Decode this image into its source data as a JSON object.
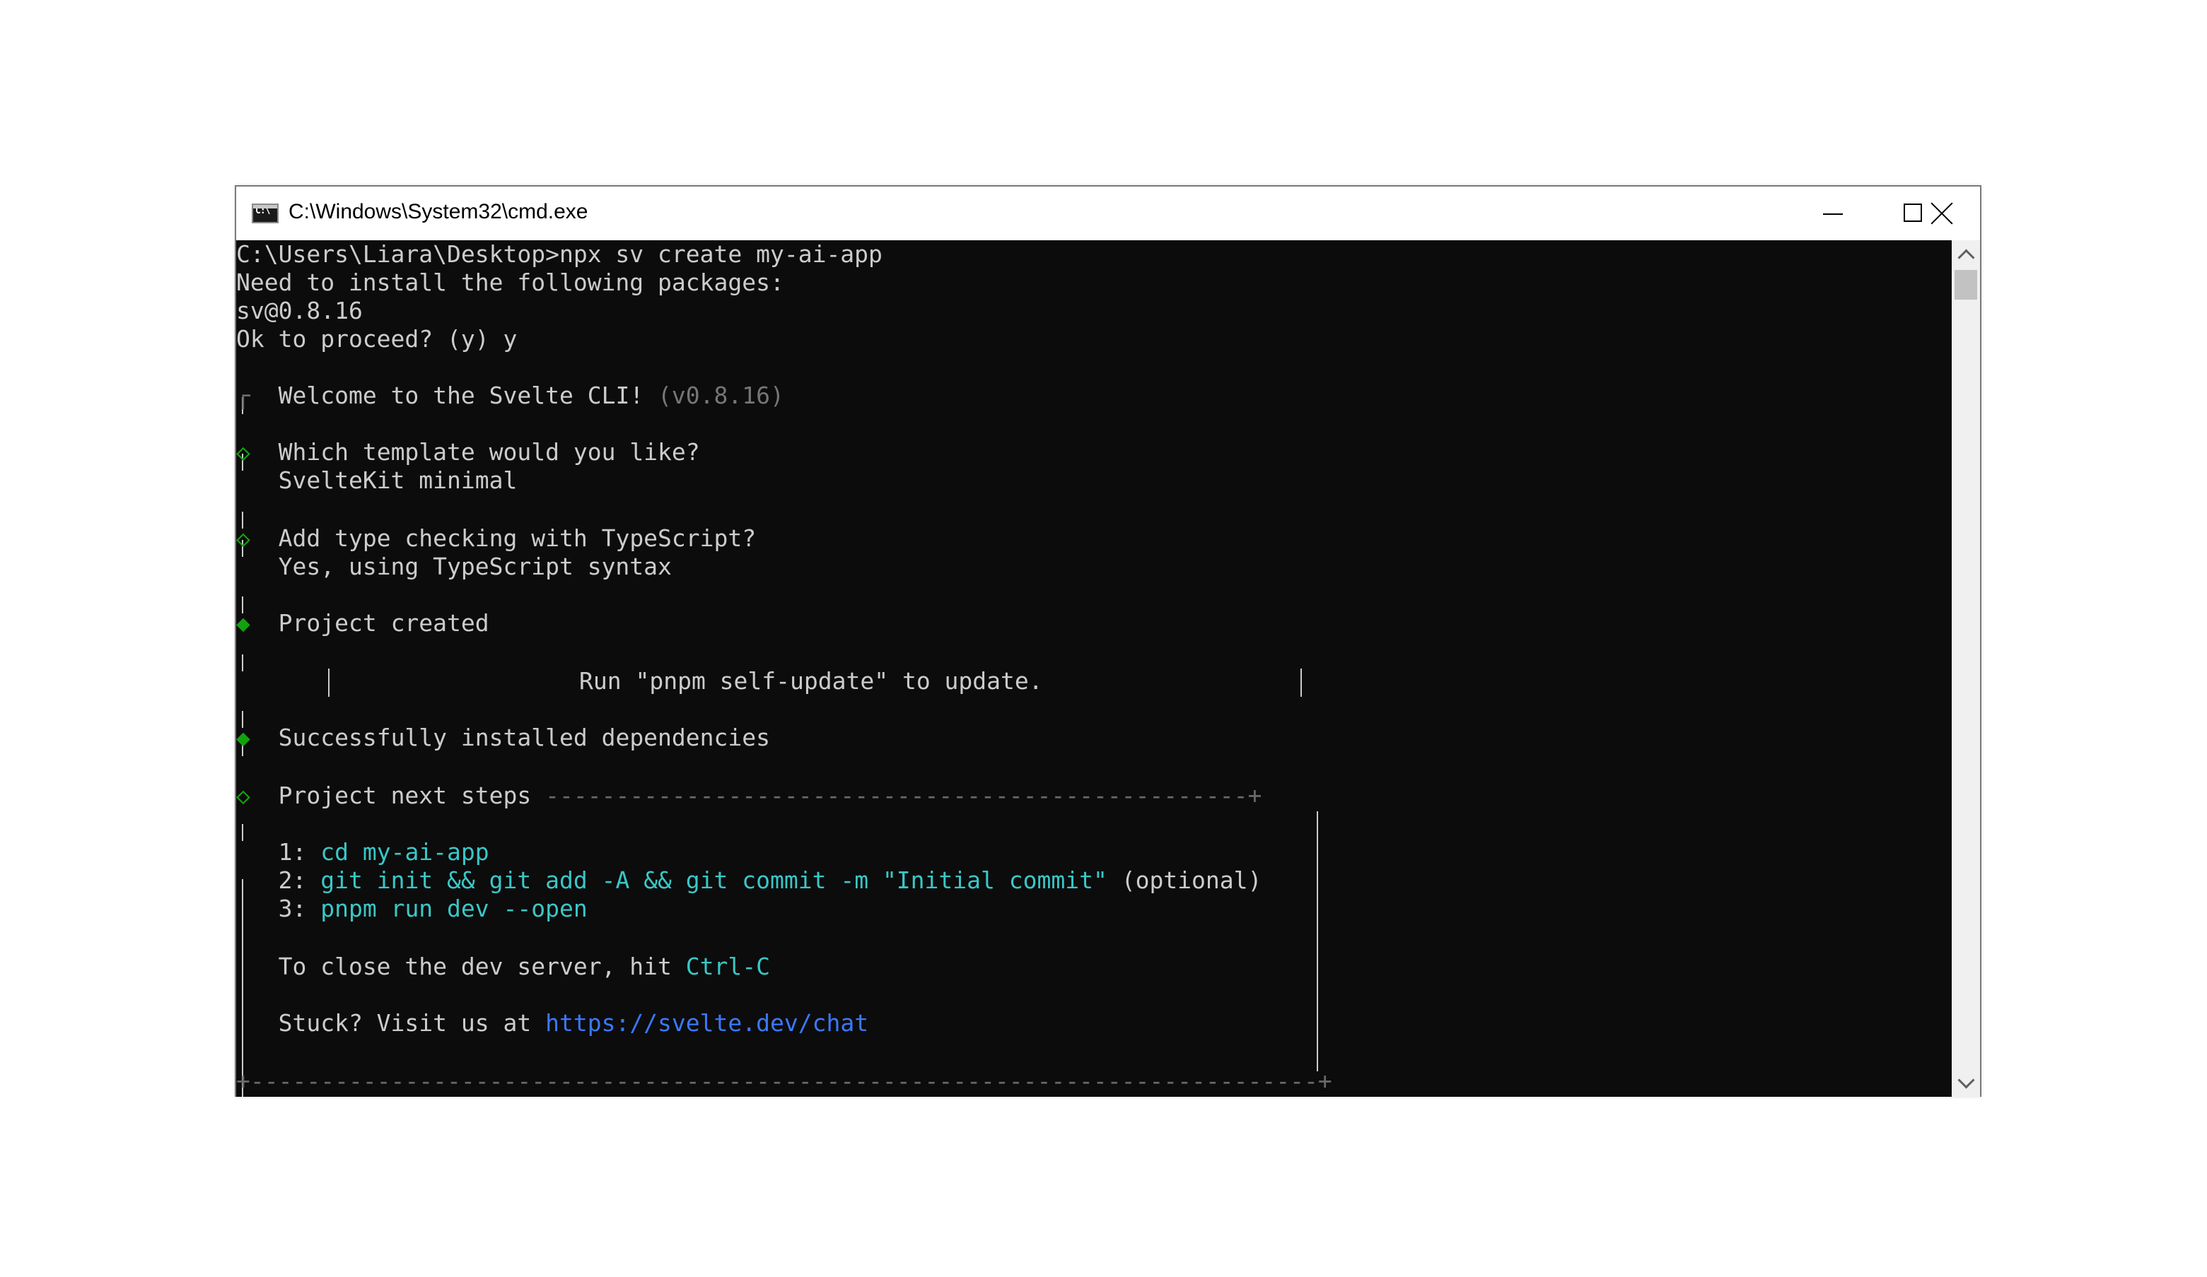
{
  "window": {
    "title": "C:\\Windows\\System32\\cmd.exe",
    "icon": "cmd-app-icon",
    "controls": {
      "minimize": "minimize-icon",
      "maximize": "maximize-icon",
      "close": "close-icon"
    }
  },
  "colors": {
    "console_bg": "#0c0c0c",
    "text": "#cccccc",
    "green": "#13a10e",
    "cyan": "#3ac7c7",
    "link_blue": "#3b78ff",
    "dim": "#767676"
  },
  "console": {
    "l1": "C:\\Users\\Liara\\Desktop>npx sv create my-ai-app",
    "l2": "Need to install the following packages:",
    "l3": "sv@0.8.16",
    "l4": "Ok to proceed? (y) y",
    "welcome": {
      "marker": "┌",
      "text": "Welcome to the Svelte CLI!",
      "version": "(v0.8.16)"
    },
    "template": {
      "marker": "◇",
      "question": "Which template would you like?",
      "answer": "SvelteKit minimal"
    },
    "typescript": {
      "marker": "◇",
      "question": "Add type checking with TypeScript?",
      "answer": "Yes, using TypeScript syntax"
    },
    "created": {
      "marker": "◆",
      "text": "Project created"
    },
    "update_notice": "Run \"pnpm self-update\" to update.",
    "installed": {
      "marker": "◆",
      "text": "Successfully installed dependencies"
    },
    "next_steps": {
      "marker": "◇",
      "title": "Project next steps",
      "rule": "--------------------------------------------------+",
      "step1_num": "1:",
      "step1_cmd": "cd my-ai-app",
      "step2_num": "2:",
      "step2_cmd": "git init && git add -A && git commit -m \"Initial commit\"",
      "step2_note": "(optional)",
      "step3_num": "3:",
      "step3_cmd": "pnpm run dev --open",
      "close_text": "To close the dev server, hit",
      "close_key": "Ctrl-C",
      "stuck_text": "Stuck? Visit us at",
      "stuck_link": "https://svelte.dev/chat",
      "bottom_rule": "+----------------------------------------------------------------------------+"
    },
    "pipe": "|"
  }
}
